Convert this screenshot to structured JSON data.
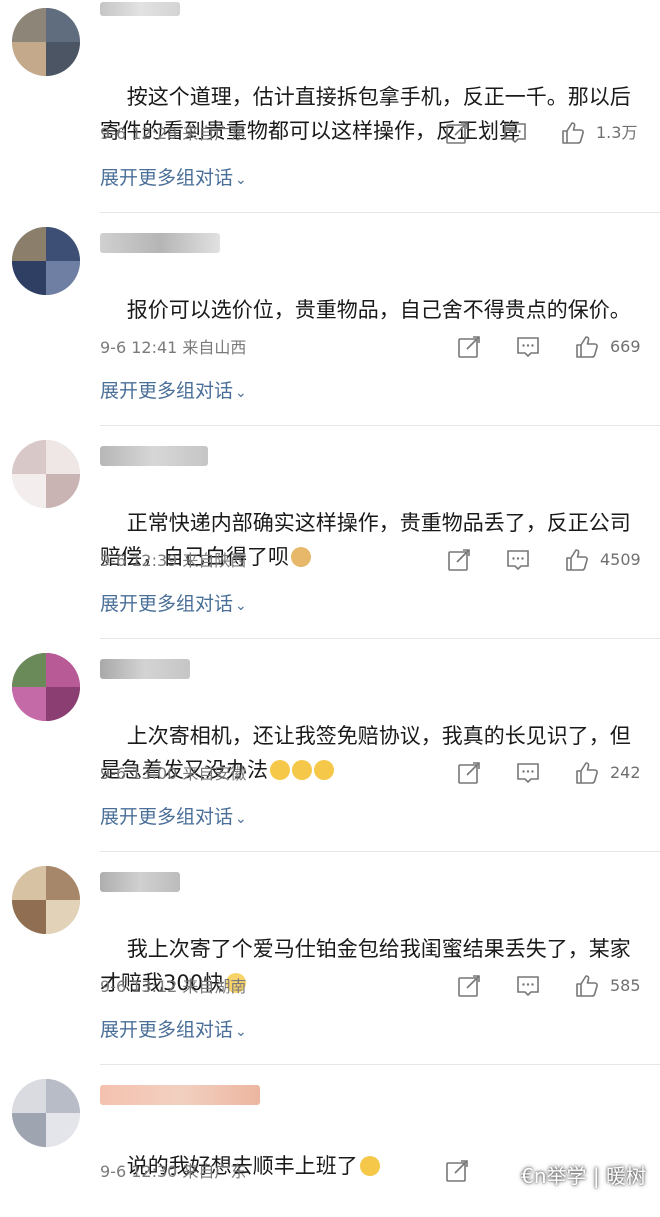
{
  "comments": [
    {
      "text": "按这个道理，估计直接拆包拿手机，反正一千。那以后寄件的看到贵重物都可以这样操作，反正划算",
      "date": "9-6 12:28",
      "location": "来自广东",
      "likes": "1.3万",
      "expand": "展开更多组对话",
      "emoji": ""
    },
    {
      "text": "报价可以选价位，贵重物品，自己舍不得贵点的保价。",
      "date": "9-6 12:41",
      "location": "来自山西",
      "likes": "669",
      "expand": "展开更多组对话",
      "emoji": ""
    },
    {
      "text": "正常快递内部确实这样操作，贵重物品丢了，反正公司赔偿，自己白得了呗",
      "date": "9-6 12:39",
      "location": "来自陕西",
      "likes": "4509",
      "expand": "展开更多组对话",
      "emoji": "doge"
    },
    {
      "text": "上次寄相机，还让我签免赔协议，我真的长见识了，但是急着发又没办法",
      "date": "9-6 13:00",
      "location": "来自安徽",
      "likes": "242",
      "expand": "展开更多组对话",
      "emoji": "crying x3"
    },
    {
      "text": "我上次寄了个爱马仕铂金包给我闺蜜结果丢失了，某家才赔我300快",
      "date": "9-6 13:12",
      "location": "来自湖南",
      "likes": "585",
      "expand": "展开更多组对话",
      "emoji": "awkward"
    },
    {
      "text": "说的我好想去顺丰上班了",
      "date": "9-6 12:30",
      "location": "来自广东",
      "likes": "",
      "expand": "",
      "emoji": "laugh-cry"
    }
  ],
  "watermark": "€n举学 | 暖树",
  "colors": {
    "link": "#4a6f98",
    "meta": "#7a7a7a",
    "divider": "#e6e6e6",
    "text": "#1a1a1a"
  },
  "icons": [
    "share-icon",
    "comment-icon",
    "like-icon"
  ]
}
